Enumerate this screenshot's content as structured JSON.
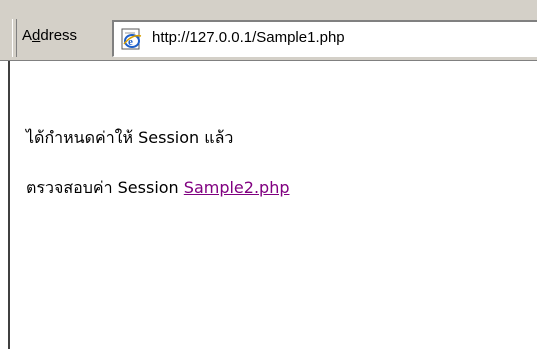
{
  "address_bar": {
    "label_accel": "d",
    "label_prefix": "A",
    "label_suffix": "dress",
    "url": "http://127.0.0.1/Sample1.php",
    "page_icon": "ie-page-icon"
  },
  "content": {
    "message": "ได้กำหนดค่าให้ Session แล้ว",
    "check_prefix": "ตรวจสอบค่า Session ",
    "link_text": "Sample2.php",
    "link_color": "#800080"
  }
}
